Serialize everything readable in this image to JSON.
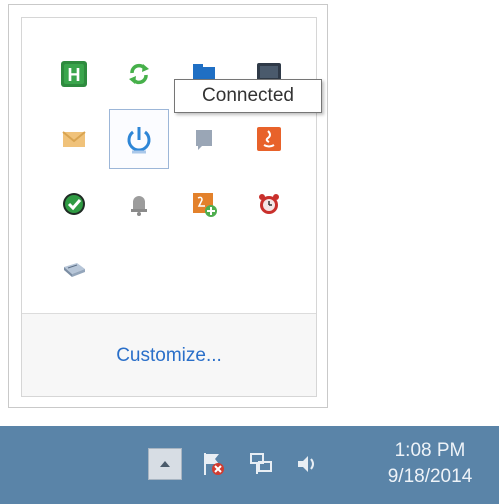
{
  "flyout": {
    "tooltip": "Connected",
    "customize_label": "Customize...",
    "icons": [
      "h-app-icon",
      "sync-icon",
      "folder-icon",
      "monitor-icon",
      "mail-icon",
      "power-icon",
      "chat-icon",
      "java-icon",
      "checkmark-shield-icon",
      "bell-icon",
      "app-update-icon",
      "alarm-clock-icon",
      "usb-drive-icon"
    ]
  },
  "taskbar": {
    "time": "1:08 PM",
    "date": "9/18/2014",
    "icons": [
      "show-hidden-icons-chevron-icon",
      "action-center-flag-icon",
      "network-icon",
      "volume-icon"
    ]
  },
  "colors": {
    "taskbar_bg": "#5a84a8",
    "link_blue": "#2a6fc9",
    "flyout_bg": "#ffffff"
  }
}
